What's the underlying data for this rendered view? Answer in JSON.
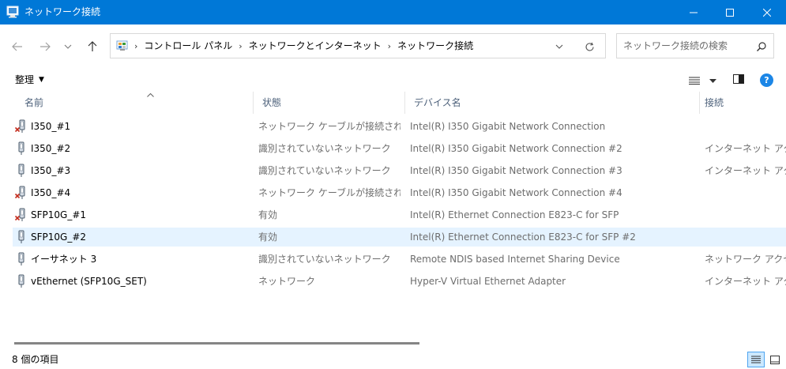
{
  "window": {
    "title": "ネットワーク接続",
    "title_bar_color": "#0078d7",
    "app_icon": "network-connections-icon",
    "controls": {
      "minimize": "minimize-icon",
      "maximize": "maximize-icon",
      "close": "close-icon"
    }
  },
  "nav": {
    "back_icon": "arrow-left-icon",
    "forward_icon": "arrow-right-icon",
    "recent_icon": "chevron-down-icon",
    "up_icon": "arrow-up-icon"
  },
  "address": {
    "location_icon": "control-panel-icon",
    "breadcrumbs": [
      "コントロール パネル",
      "ネットワークとインターネット",
      "ネットワーク接続"
    ],
    "separator": "›",
    "dropdown_icon": "chevron-down-icon",
    "refresh_icon": "refresh-icon"
  },
  "search": {
    "placeholder": "ネットワーク接続の検索",
    "value": "",
    "icon": "search-icon"
  },
  "command_bar": {
    "organize_label": "整理",
    "organize_caret": "▼",
    "view_menu_icon": "view-options-icon",
    "preview_pane_icon": "preview-pane-icon",
    "help_label": "?",
    "help_color": "#1c86e6"
  },
  "columns": [
    "名前",
    "状態",
    "デバイス名",
    "接続"
  ],
  "sort_indicator": "^",
  "rows": [
    {
      "name": "I350_#1",
      "status": "ネットワーク ケーブルが接続されてい...",
      "device": "Intel(R) I350 Gigabit Network Connection",
      "connectivity": "",
      "disconnected": true,
      "selected": false
    },
    {
      "name": "I350_#2",
      "status": "識別されていないネットワーク",
      "device": "Intel(R) I350 Gigabit Network Connection #2",
      "connectivity": "インターネット アクセスなし",
      "disconnected": false,
      "selected": false
    },
    {
      "name": "I350_#3",
      "status": "識別されていないネットワーク",
      "device": "Intel(R) I350 Gigabit Network Connection #3",
      "connectivity": "インターネット アクセスなし",
      "disconnected": false,
      "selected": false
    },
    {
      "name": "I350_#4",
      "status": "ネットワーク ケーブルが接続されてい...",
      "device": "Intel(R) I350 Gigabit Network Connection #4",
      "connectivity": "",
      "disconnected": true,
      "selected": false
    },
    {
      "name": "SFP10G_#1",
      "status": "有効",
      "device": "Intel(R) Ethernet Connection E823-C for SFP",
      "connectivity": "",
      "disconnected": true,
      "selected": false
    },
    {
      "name": "SFP10G_#2",
      "status": "有効",
      "device": "Intel(R) Ethernet Connection E823-C for SFP #2",
      "connectivity": "",
      "disconnected": false,
      "selected": true
    },
    {
      "name": "イーサネット 3",
      "status": "識別されていないネットワーク",
      "device": "Remote NDIS based Internet Sharing Device",
      "connectivity": "ネットワーク アクセスなし",
      "disconnected": false,
      "selected": false
    },
    {
      "name": "vEthernet (SFP10G_SET)",
      "status": "ネットワーク",
      "device": "Hyper-V Virtual Ethernet Adapter",
      "connectivity": "インターネット アクセスなし",
      "disconnected": false,
      "selected": false
    }
  ],
  "status_bar": {
    "item_count": "8 個の項目",
    "details_view_icon": "details-view-icon",
    "large_icons_view_icon": "large-icons-view-icon"
  },
  "colors": {
    "selection": "#e5f3ff",
    "header_text": "#4c607a",
    "disconnect_x": "#c42b1c"
  }
}
